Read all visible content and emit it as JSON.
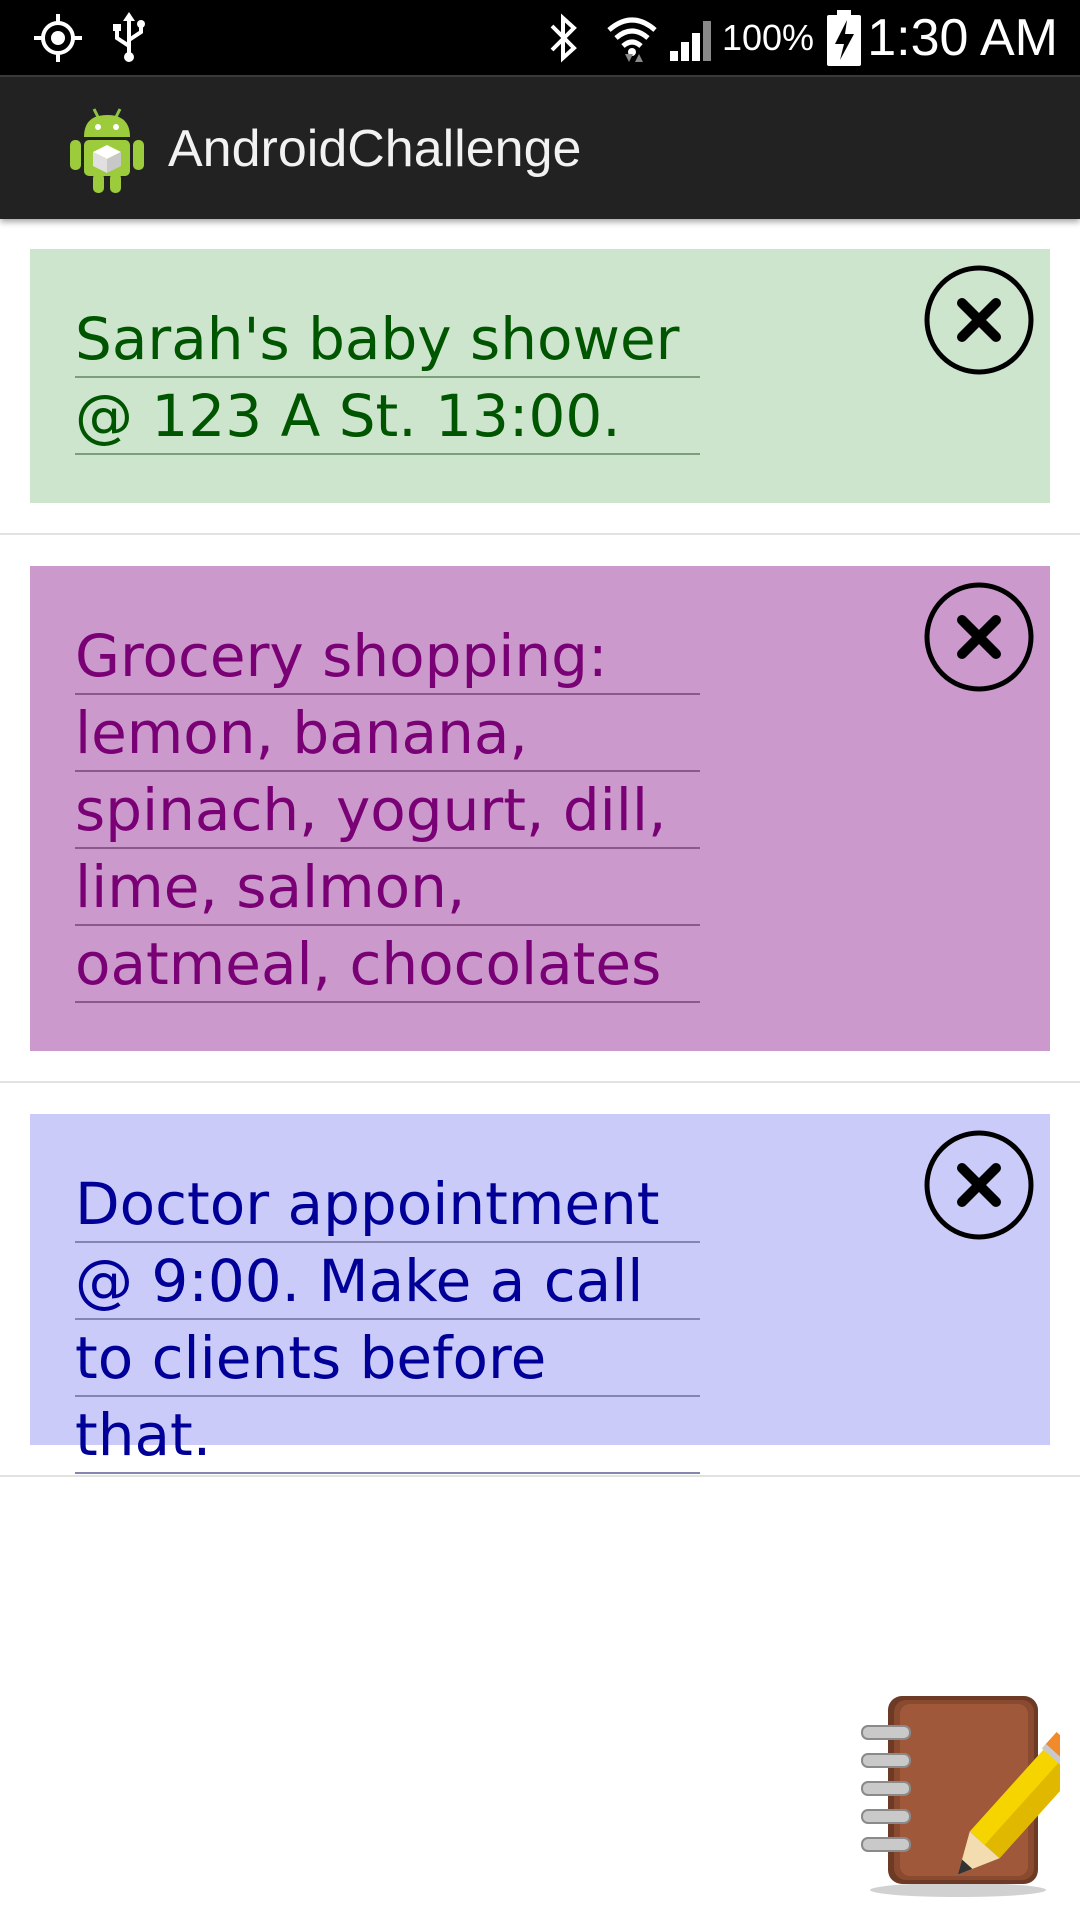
{
  "status_bar": {
    "time": "1:30 AM",
    "battery_percent": "100%",
    "icons": [
      "gps-icon",
      "usb-icon",
      "bluetooth-icon",
      "wifi-icon",
      "signal-icon",
      "battery-charging-icon"
    ]
  },
  "action_bar": {
    "app_icon": "android-app-icon",
    "title": "AndroidChallenge"
  },
  "notes": [
    {
      "text": "Sarah's baby shower\n@ 123 A St. 13:00.",
      "background": "#cde5cd",
      "text_color": "#005500",
      "close_icon": "close-circle-icon"
    },
    {
      "text": "Grocery shopping:\nlemon, banana,\nspinach, yogurt, dill,\nlime, salmon,\noatmeal, chocolates",
      "background": "#cc99cc",
      "text_color": "#7a0075",
      "close_icon": "close-circle-icon"
    },
    {
      "text": "Doctor appointment\n@ 9:00. Make a call\nto clients before that.",
      "background": "#cbcbfa",
      "text_color": "#000099",
      "close_icon": "close-circle-icon"
    }
  ],
  "fab": {
    "icon": "notebook-pencil-icon"
  }
}
